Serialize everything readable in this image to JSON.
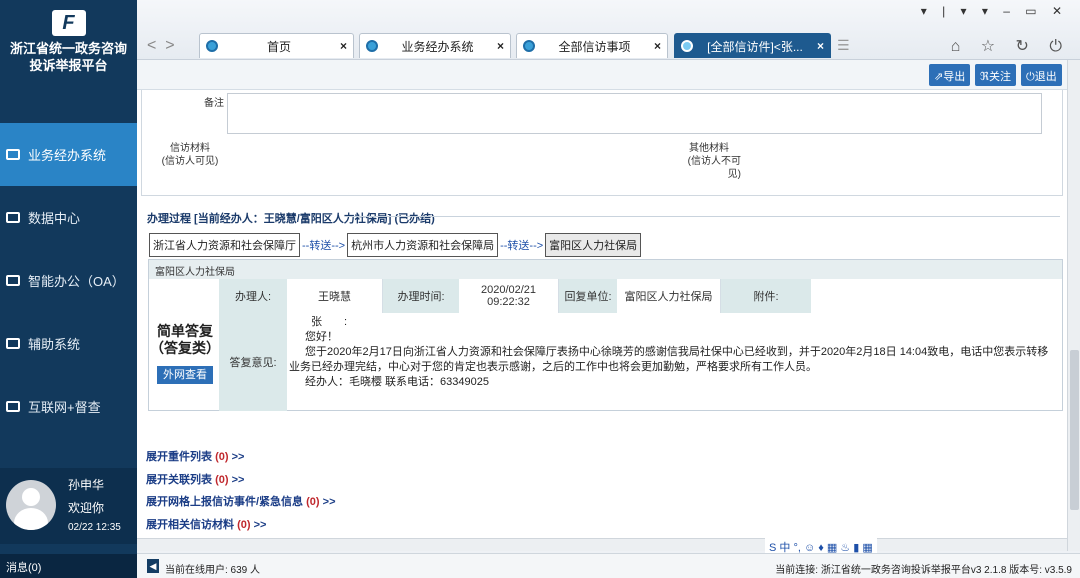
{
  "sidebar": {
    "logo_glyph": "F",
    "logo_line1": "浙江省统一政务咨询",
    "logo_line2": "投诉举报平台",
    "items": [
      {
        "label": "业务经办系统",
        "icon": "folder-icon"
      },
      {
        "label": "数据中心",
        "icon": "chart-icon"
      },
      {
        "label": "智能办公（OA）",
        "icon": "folder-icon"
      },
      {
        "label": "辅助系统",
        "icon": "folder-icon"
      },
      {
        "label": "互联网+督查",
        "icon": "folder-icon"
      }
    ],
    "user": {
      "name": "孙申华",
      "welcome": "欢迎你",
      "date": "02/22 12:35"
    },
    "messages": "消息(0)"
  },
  "window_controls": "▾ | ▾ ▾ – ▭ ✕",
  "browser_icons": "⌂ ☆ ↻ ⏻",
  "tabs": [
    {
      "label": "首页",
      "close": "×"
    },
    {
      "label": "业务经办系统",
      "close": "×"
    },
    {
      "label": "全部信访事项",
      "close": "×"
    },
    {
      "label": "[全部信访件]<张...",
      "close": "×"
    }
  ],
  "toolbar": {
    "export": "⇗导出",
    "follow": "ℜ关注",
    "exit": "⏻退出"
  },
  "form": {
    "remark_label": "备注",
    "material_label_1": "信访材料",
    "material_label_2": "(信访人可见)",
    "other_label_1": "其他材料",
    "other_label_2": "(信访人不可",
    "other_label_3": "见)"
  },
  "process": {
    "title": "办理过程 [当前经办人：王晓慧/富阳区人力社保局] (已办结)",
    "flow": [
      "浙江省人力资源和社会保障厅",
      "--转送-->",
      "杭州市人力资源和社会保障局",
      "--转送-->",
      "富阳区人力社保局"
    ],
    "section_title": "富阳区人力社保局",
    "reply_type_1": "简单答复",
    "reply_type_2": "（答复类）",
    "view_button": "外网查看",
    "handler_label": "办理人:",
    "handler": "王晓慧",
    "time_label": "办理时间:",
    "time_date": "2020/02/21",
    "time_clock": "09:22:32",
    "unit_label": "回复单位:",
    "unit": "富阳区人力社保局",
    "attach_label": "附件:",
    "opinion_label": "答复意见:",
    "reply_line1": "张　　:",
    "reply_line2": "您好！",
    "reply_line3": "您于2020年2月17日向浙江省人力资源和社会保障厅表扬中心徐晓芳的感谢信我局社保中心已经收到，并于2020年2月18日 14:04致电，电话中您表示转移",
    "reply_line4": "业务已经办理完结，中心对于您的肯定也表示感谢，之后的工作中也将会更加勤勉，严格要求所有工作人员。",
    "reply_line5": "经办人：毛晓樱 联系电话：63349025"
  },
  "links": [
    {
      "label": "展开重件列表",
      "count": "(0)",
      "arrow": ">>"
    },
    {
      "label": "展开关联列表",
      "count": "(0)",
      "arrow": ">>"
    },
    {
      "label": "展开网格上报信访事件/紧急信息",
      "count": "(0)",
      "arrow": ">>"
    },
    {
      "label": "展开相关信访材料",
      "count": "(0)",
      "arrow": ">>"
    }
  ],
  "ime": "S 中 °, ☺ ♦ ▦ ♨ ▮ ▦",
  "status": {
    "online": "当前在线用户: 639 人",
    "connection": "当前连接: 浙江省统一政务咨询投诉举报平台v3 2.1.8 版本号: v3.5.9"
  }
}
